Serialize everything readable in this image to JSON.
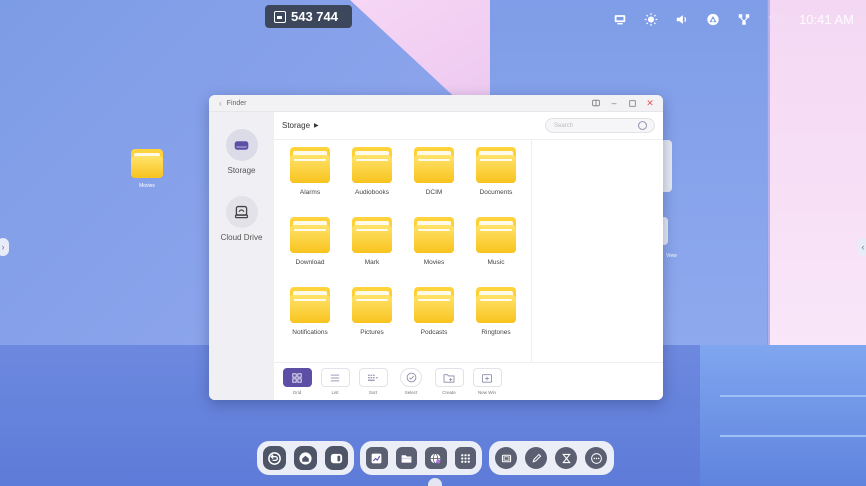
{
  "top": {
    "counter": "543 744",
    "clock": "10:41 AM"
  },
  "desktop": {
    "folder_label": "Movies",
    "ghost_label": "View"
  },
  "finder": {
    "title": "Finder",
    "sidebar": [
      {
        "label": "Storage",
        "icon": "storage-icon"
      },
      {
        "label": "Cloud Drive",
        "icon": "cloud-drive-icon"
      }
    ],
    "path": "Storage",
    "search_placeholder": "Search",
    "folders": [
      "Alarms",
      "Audiobooks",
      "DCIM",
      "Documents",
      "Download",
      "Mark",
      "Movies",
      "Music",
      "Notifications",
      "Pictures",
      "Podcasts",
      "Ringtones"
    ],
    "toolbar": {
      "grid": "Grid",
      "list": "List",
      "sort": "Sort",
      "select": "Select",
      "create": "Create",
      "new_win": "New Win"
    }
  },
  "colors": {
    "accent": "#5e4fa6",
    "folder": "#f9c01a"
  }
}
